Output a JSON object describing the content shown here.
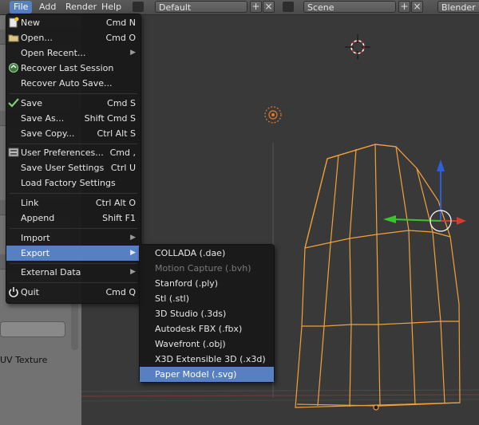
{
  "header": {
    "menus": [
      {
        "label": "File",
        "active": true
      },
      {
        "label": "Add"
      },
      {
        "label": "Render"
      },
      {
        "label": "Help"
      }
    ],
    "layout_field": "Default",
    "scene_field": "Scene",
    "render_engine": "Blender Re"
  },
  "left_panel": {
    "uv_texture_label": "UV Texture"
  },
  "file_menu": {
    "items": [
      {
        "label": "New",
        "shortcut": "Cmd N",
        "icon": "new-file-icon"
      },
      {
        "label": "Open...",
        "shortcut": "Cmd O",
        "icon": "folder-icon"
      },
      {
        "label": "Open Recent...",
        "submenu": true
      },
      {
        "label": "Recover Last Session",
        "icon": "recover-icon"
      },
      {
        "label": "Recover Auto Save..."
      },
      {
        "label": "Save",
        "shortcut": "Cmd S",
        "icon": "checkmark-icon"
      },
      {
        "label": "Save As...",
        "shortcut": "Shift Cmd S"
      },
      {
        "label": "Save Copy...",
        "shortcut": "Ctrl Alt S"
      },
      {
        "label": "User Preferences...",
        "shortcut": "Cmd ,",
        "icon": "preferences-icon"
      },
      {
        "label": "Save User Settings",
        "shortcut": "Ctrl U"
      },
      {
        "label": "Load Factory Settings"
      },
      {
        "label": "Link",
        "shortcut": "Ctrl Alt O"
      },
      {
        "label": "Append",
        "shortcut": "Shift F1"
      },
      {
        "label": "Import",
        "submenu": true
      },
      {
        "label": "Export",
        "submenu": true,
        "highlighted": true
      },
      {
        "label": "External Data",
        "submenu": true
      },
      {
        "label": "Quit",
        "shortcut": "Cmd Q",
        "icon": "power-icon"
      }
    ]
  },
  "export_menu": {
    "items": [
      {
        "label": "COLLADA (.dae)"
      },
      {
        "label": "Motion Capture (.bvh)",
        "disabled": true
      },
      {
        "label": "Stanford (.ply)"
      },
      {
        "label": "Stl (.stl)"
      },
      {
        "label": "3D Studio (.3ds)"
      },
      {
        "label": "Autodesk FBX (.fbx)"
      },
      {
        "label": "Wavefront (.obj)"
      },
      {
        "label": "X3D Extensible 3D (.x3d)"
      },
      {
        "label": "Paper Model (.svg)",
        "highlighted": true
      }
    ]
  },
  "colors": {
    "highlight": "#5680c2",
    "mesh_wire": "#f2a13a",
    "axis_x": "#d83b2b",
    "axis_y": "#3cc32d",
    "axis_z": "#2f5fd8"
  }
}
